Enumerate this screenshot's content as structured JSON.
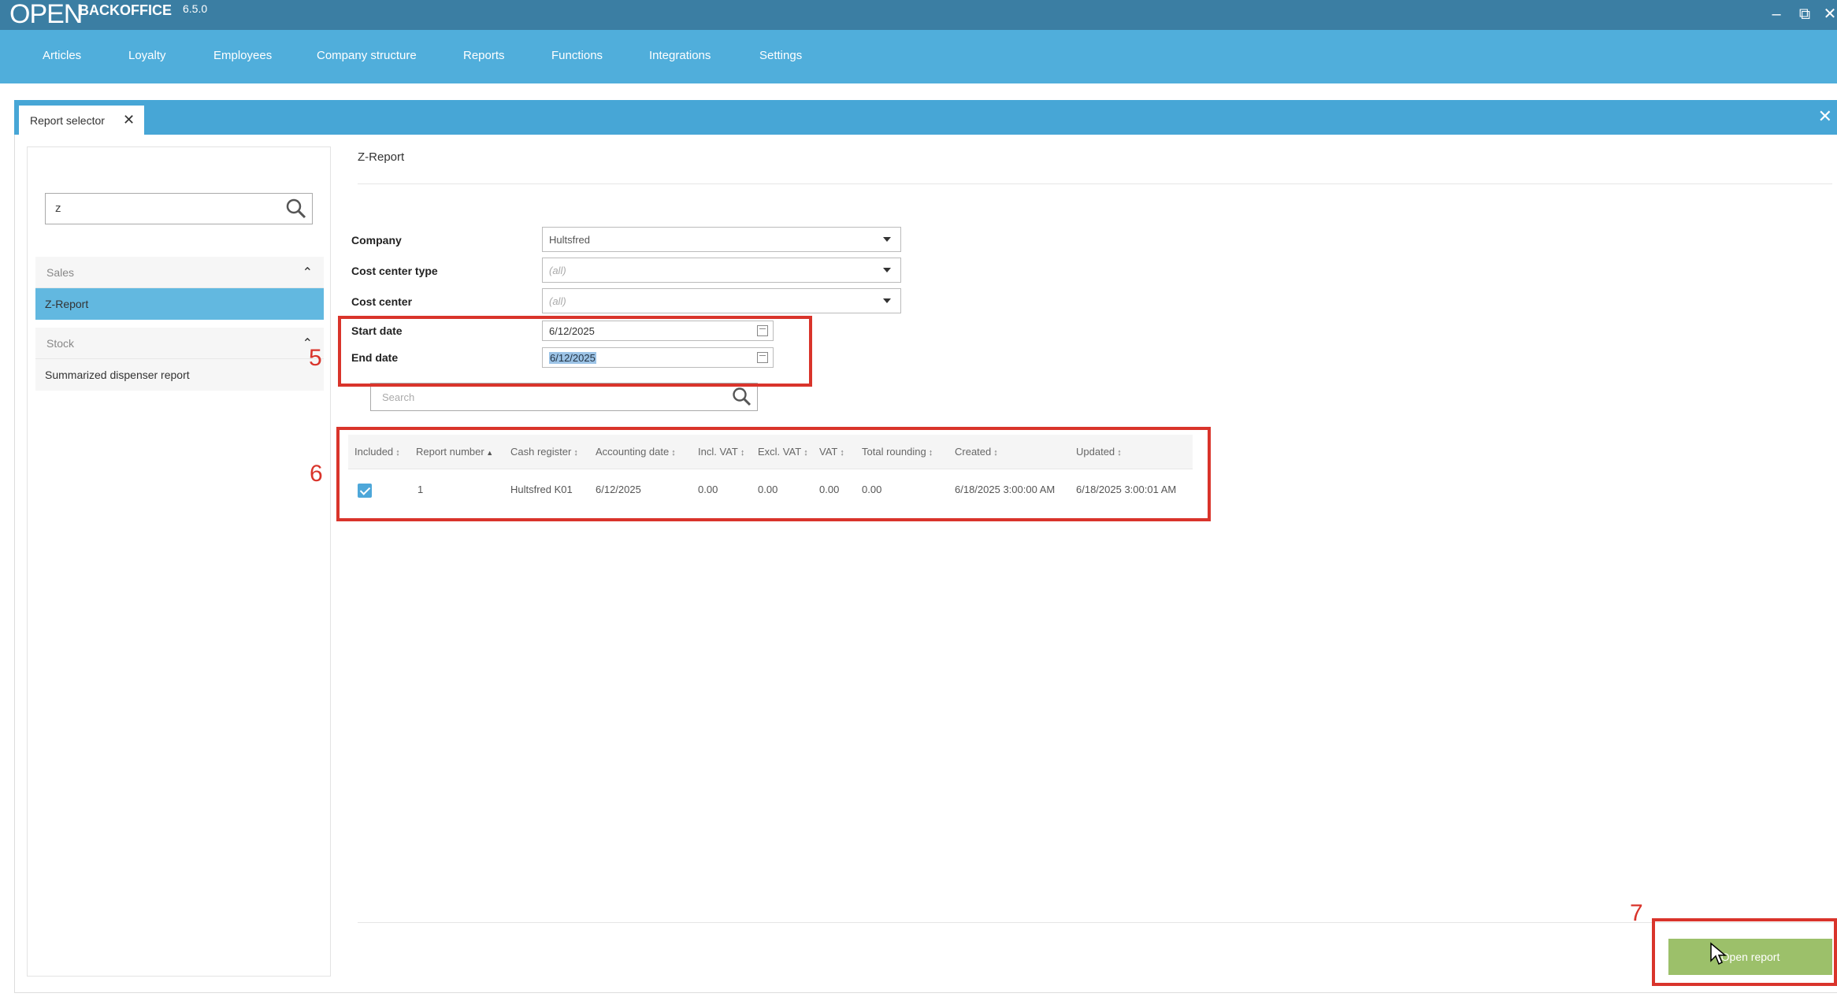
{
  "app": {
    "logo": "OPEN",
    "name": "BACKOFFICE",
    "version": "6.5.0"
  },
  "nav": {
    "items": [
      "Articles",
      "Loyalty",
      "Employees",
      "Company structure",
      "Reports",
      "Functions",
      "Integrations",
      "Settings"
    ]
  },
  "tab": {
    "label": "Report selector",
    "close_icon": "close-icon"
  },
  "sidebar": {
    "search_value": "z",
    "groups": [
      {
        "label": "Sales",
        "items": [
          "Z-Report"
        ]
      },
      {
        "label": "Stock",
        "items": [
          "Summarized dispenser report"
        ]
      }
    ],
    "selected_item": "Z-Report",
    "selected_color": "#62b8e0"
  },
  "report": {
    "title": "Z-Report",
    "company_label": "Company",
    "company_value": "Hultsfred",
    "cost_center_type_label": "Cost center type",
    "cost_center_type_value": "(all)",
    "cost_center_label": "Cost center",
    "cost_center_value": "(all)",
    "start_date_label": "Start date",
    "start_date_value": "6/12/2025",
    "end_date_label": "End date",
    "end_date_value": "6/12/2025",
    "search_placeholder": "Search"
  },
  "grid": {
    "columns": [
      "Included",
      "Report number",
      "Cash register",
      "Accounting date",
      "Incl. VAT",
      "Excl. VAT",
      "VAT",
      "Total rounding",
      "Created",
      "Updated"
    ],
    "rows": [
      {
        "included": true,
        "report_number": "1",
        "cash_register": "Hultsfred K01",
        "accounting_date": "6/12/2025",
        "incl_vat": "0.00",
        "excl_vat": "0.00",
        "vat": "0.00",
        "total_rounding": "0.00",
        "created": "6/18/2025 3:00:00 AM",
        "updated": "6/18/2025 3:00:01 AM"
      }
    ]
  },
  "footer": {
    "open_report_label": "Open report",
    "open_report_color": "#9cc06a"
  },
  "annotations": {
    "labels": [
      "5",
      "6",
      "7"
    ],
    "color": "#d9342b"
  },
  "colors": {
    "titlebar": "#3b7ea3",
    "navbar": "#50aedb",
    "tabstrip": "#47a6d6"
  }
}
